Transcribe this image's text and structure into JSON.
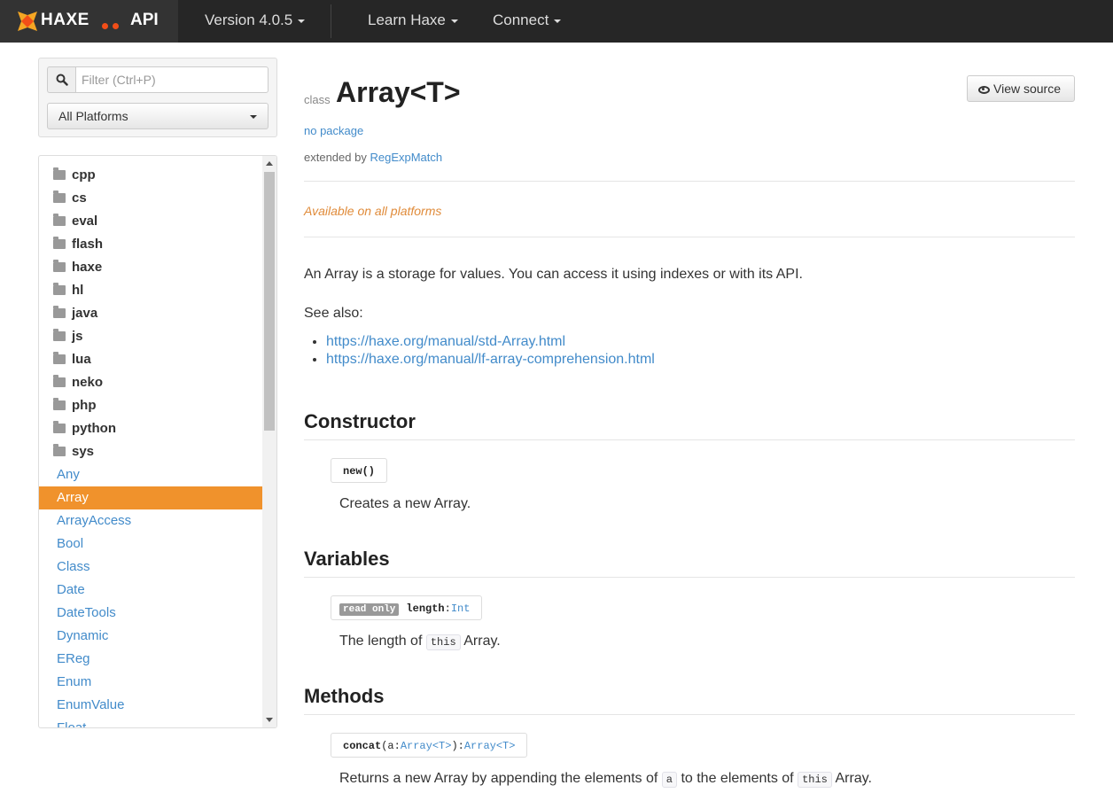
{
  "nav": {
    "logo_text": "HAXE",
    "api_label": "API",
    "version": "Version 4.0.5",
    "learn": "Learn Haxe",
    "connect": "Connect"
  },
  "sidebar": {
    "filter_placeholder": "Filter (Ctrl+P)",
    "platform": "All Platforms",
    "packages": [
      "cpp",
      "cs",
      "eval",
      "flash",
      "haxe",
      "hl",
      "java",
      "js",
      "lua",
      "neko",
      "php",
      "python",
      "sys"
    ],
    "classes": [
      "Any",
      "Array",
      "ArrayAccess",
      "Bool",
      "Class",
      "Date",
      "DateTools",
      "Dynamic",
      "EReg",
      "Enum",
      "EnumValue",
      "Float"
    ],
    "active_class": "Array"
  },
  "page": {
    "kind": "class",
    "title": "Array<T>",
    "view_source": "View source",
    "package": "no package",
    "extended_by_label": "extended by",
    "extended_by": "RegExpMatch",
    "availability": "Available on all platforms",
    "description": "An Array is a storage for values. You can access it using indexes or with its API.",
    "see_also": "See also:",
    "links": [
      "https://haxe.org/manual/std-Array.html",
      "https://haxe.org/manual/lf-array-comprehension.html"
    ]
  },
  "constructor": {
    "heading": "Constructor",
    "signature": "new()",
    "description": "Creates a new Array."
  },
  "variables": {
    "heading": "Variables",
    "badge": "read only",
    "name": "length",
    "type": "Int",
    "desc_before": "The length of",
    "desc_code": "this",
    "desc_after": "Array."
  },
  "methods": {
    "heading": "Methods",
    "name": "concat",
    "param": "a",
    "param_type": "Array<T>",
    "return_type": "Array<T>",
    "desc_1": "Returns a new Array by appending the elements of",
    "desc_code_1": "a",
    "desc_2": "to the elements of",
    "desc_code_2": "this",
    "desc_3": "Array."
  },
  "colors": {
    "nav_bg": "#262626",
    "brand_bg": "#333333",
    "accent_orange": "#f0922c",
    "link_blue": "#428bca",
    "haxe_orange": "#f24e18"
  }
}
